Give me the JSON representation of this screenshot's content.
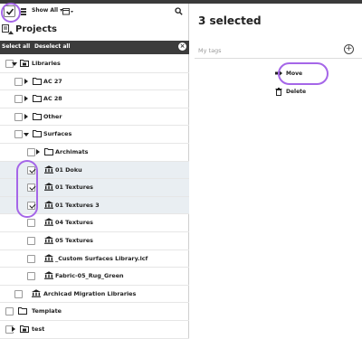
{
  "toolbar": {
    "filter_label": "Show All",
    "search_icon": "search-icon"
  },
  "projects": {
    "title": "Projects"
  },
  "selection_bar": {
    "select_all": "Select all",
    "deselect_all": "Deselect all"
  },
  "tree": [
    {
      "label": "Libraries",
      "checked": false,
      "expanded": true,
      "arrow": "down",
      "icon": "library-folder-icon"
    },
    {
      "label": "AC 27",
      "checked": false,
      "arrow": "right",
      "icon": "folder-icon"
    },
    {
      "label": "AC 28",
      "checked": false,
      "arrow": "right",
      "icon": "folder-icon"
    },
    {
      "label": "Other",
      "checked": false,
      "arrow": "right",
      "icon": "folder-icon"
    },
    {
      "label": "Surfaces",
      "checked": false,
      "arrow": "down",
      "icon": "folder-icon"
    },
    {
      "label": "Archimats",
      "checked": false,
      "arrow": "right",
      "icon": "folder-icon"
    },
    {
      "label": "01 Doku",
      "checked": true,
      "icon": "library-icon"
    },
    {
      "label": "01 Textures",
      "checked": true,
      "icon": "library-icon"
    },
    {
      "label": "01 Textures 3",
      "checked": true,
      "icon": "library-icon"
    },
    {
      "label": "04 Textures",
      "checked": false,
      "icon": "library-icon"
    },
    {
      "label": "05 Textures",
      "checked": false,
      "icon": "library-icon"
    },
    {
      "label": "_Custom Surfaces Library.lcf",
      "checked": false,
      "icon": "library-icon"
    },
    {
      "label": "Fabric-05_Rug_Green",
      "checked": false,
      "icon": "library-icon"
    },
    {
      "label": "Archicad Migration Libraries",
      "checked": false,
      "icon": "library-icon"
    },
    {
      "label": "Template",
      "checked": false,
      "icon": "folder-icon"
    },
    {
      "label": "test",
      "checked": false,
      "arrow": "right",
      "icon": "library-folder-icon"
    }
  ],
  "detail": {
    "title": "3 selected",
    "tags_placeholder": "My tags",
    "actions": [
      {
        "label": "Move",
        "icon": "move-arrow-icon"
      },
      {
        "label": "Delete",
        "icon": "trash-icon"
      }
    ]
  },
  "colors": {
    "highlight_circle": "#a566e8",
    "selection_bar": "#3c3c3c",
    "selected_row": "#e9eef2"
  }
}
